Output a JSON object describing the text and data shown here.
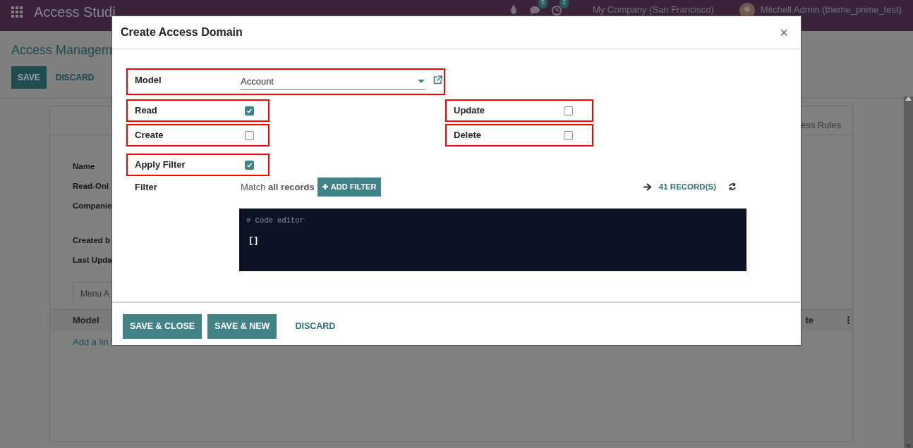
{
  "navbar": {
    "app_title": "Access Studi",
    "messages_count": "5",
    "activities_count": "2",
    "company": "My Company (San Francisco)",
    "user": "Mitchell Admin (theme_prime_test)"
  },
  "background_form": {
    "title": "Access Managem",
    "buttons": [
      {
        "label": "SAVE",
        "kind": "primary"
      },
      {
        "label": "DISCARD",
        "kind": "link"
      }
    ],
    "tab_right": "ess Rules",
    "field_groups": [
      [
        "Name",
        "Read-Onl",
        "Companie"
      ],
      [
        "Created b",
        "Last Upda"
      ]
    ],
    "notebook_tab": "Menu A",
    "table_columns": [
      "Model",
      "te"
    ],
    "add_line": "Add a lin"
  },
  "dialog": {
    "title": "Create Access Domain",
    "close": "×",
    "model": {
      "label": "Model",
      "value": "Account",
      "highlighted": true
    },
    "permissions": [
      {
        "label": "Read",
        "checked": true,
        "highlighted": true
      },
      {
        "label": "Update",
        "checked": false,
        "highlighted": true
      },
      {
        "label": "Create",
        "checked": false,
        "highlighted": true
      },
      {
        "label": "Delete",
        "checked": false,
        "highlighted": true
      }
    ],
    "apply_filter": {
      "label": "Apply Filter",
      "checked": true,
      "highlighted": true
    },
    "filter": {
      "label": "Filter",
      "match_text": "Match **all records**",
      "add_button": "ADD FILTER",
      "records": "41 RECORD(S)"
    },
    "code_editor": {
      "comment": "# Code editor",
      "value": "[]"
    },
    "footer_buttons": [
      {
        "label": "SAVE & CLOSE",
        "kind": "primary"
      },
      {
        "label": "SAVE & NEW",
        "kind": "primary"
      },
      {
        "label": "DISCARD",
        "kind": "link"
      }
    ]
  }
}
